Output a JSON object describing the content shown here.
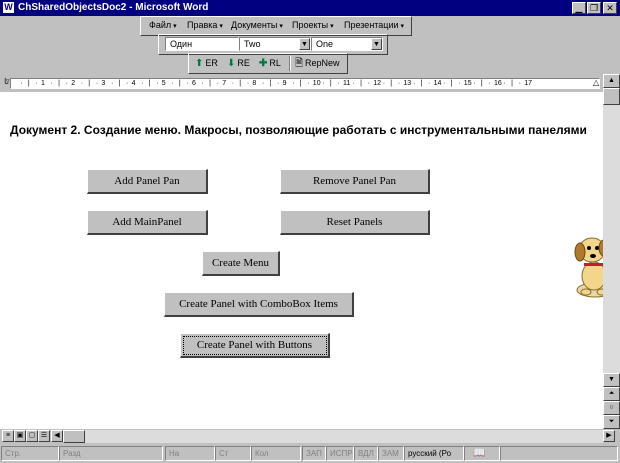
{
  "window": {
    "title": "ChSharedObjectsDoc2 - Microsoft Word",
    "app_icon": "W"
  },
  "menu": {
    "items": [
      {
        "label": "Файл"
      },
      {
        "label": "Правка"
      },
      {
        "label": "Документы"
      },
      {
        "label": "Проекты"
      },
      {
        "label": "Презентации"
      }
    ]
  },
  "combos": [
    {
      "value": "Один"
    },
    {
      "value": "Two"
    },
    {
      "value": "One"
    }
  ],
  "toolbar_buttons": [
    {
      "label": "ER",
      "icon": "arrow-up-icon"
    },
    {
      "label": "RE",
      "icon": "arrow-down-icon"
    },
    {
      "label": "RL",
      "icon": "plus-icon"
    },
    {
      "label": "RepNew",
      "icon": "document-icon"
    }
  ],
  "ruler": {
    "ticks": [
      "1",
      "2",
      "3",
      "4",
      "5",
      "6",
      "7",
      "8",
      "9",
      "10",
      "11",
      "12",
      "13",
      "14",
      "15",
      "16",
      "17"
    ]
  },
  "document": {
    "heading": "Документ 2. Создание меню. Макросы, позволяющие работать с инструментальными панелями",
    "buttons": {
      "add_panel_pan": "Add Panel Pan",
      "remove_panel_pan": "Remove Panel Pan",
      "add_mainpanel": "Add MainPanel",
      "reset_panels": "Reset Panels",
      "create_menu": "Create Menu",
      "create_panel_combobox": "Create Panel with ComboBox Items",
      "create_panel_buttons": "Create Panel with Buttons"
    }
  },
  "status": {
    "page": "Стр.",
    "section": "Разд",
    "position": "На",
    "line": "Ст",
    "column": "Кол",
    "rec": "ЗАП",
    "track": "ИСПР",
    "ext": "ВДЛ",
    "ovr": "ЗАМ",
    "language": "русский (Ро"
  },
  "colors": {
    "titlebar": "#000080",
    "face": "#c0c0c0",
    "page": "#ffffff"
  }
}
